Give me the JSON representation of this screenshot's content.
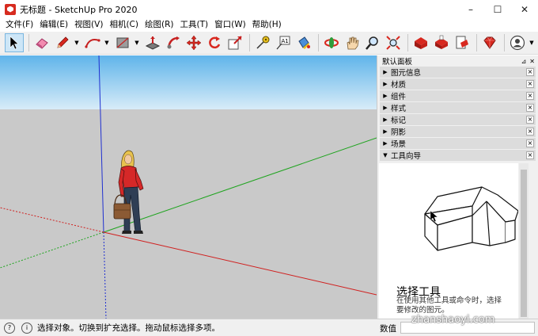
{
  "window": {
    "title": "无标题 - SketchUp Pro 2020",
    "minimize": "–",
    "maximize": "☐",
    "close": "✕"
  },
  "menu": [
    "文件(F)",
    "编辑(E)",
    "视图(V)",
    "相机(C)",
    "绘图(R)",
    "工具(T)",
    "窗口(W)",
    "帮助(H)"
  ],
  "toolbar": {
    "tools": [
      "select-tool",
      "eraser-tool",
      "pencil-tool",
      "arc-tool",
      "shape-tool",
      "push-pull-tool",
      "follow-me-tool",
      "move-tool",
      "rotate-tool",
      "scale-tool",
      "tape-measure-tool",
      "text-tool",
      "paint-bucket-tool",
      "orbit-tool",
      "pan-tool",
      "zoom-tool",
      "zoom-extents-tool",
      "3d-warehouse-tool",
      "extension-warehouse-tool",
      "layout-tool",
      "extension-manager-tool",
      "account-tool"
    ],
    "text_tool_glyph": "A1"
  },
  "tray": {
    "title": "默认面板",
    "pin": "⊿",
    "close": "✕",
    "panels": [
      {
        "label": "图元信息",
        "expanded": false
      },
      {
        "label": "材质",
        "expanded": false
      },
      {
        "label": "组件",
        "expanded": false
      },
      {
        "label": "样式",
        "expanded": false
      },
      {
        "label": "标记",
        "expanded": false
      },
      {
        "label": "阴影",
        "expanded": false
      },
      {
        "label": "场景",
        "expanded": false
      },
      {
        "label": "工具向导",
        "expanded": true
      }
    ],
    "collapsed_glyph": "▶",
    "expanded_glyph": "▼",
    "close_glyph": "×",
    "instructor": {
      "title": "选择工具",
      "description": "在使用其他工具或命令时，选择要修改的图元。"
    }
  },
  "status": {
    "text": "选择对象。切换到扩充选择。拖动鼠标选择多项。",
    "measure_label": "数值",
    "measure_value": ""
  },
  "watermark": "zhanshaoyi.com",
  "colors": {
    "sky_top": "#5fb4ea",
    "sky_bottom": "#d8ecf8",
    "ground": "#c9c9c9",
    "axis_red": "#d0201f",
    "axis_green": "#1fa41f",
    "axis_blue": "#1f2fd0",
    "active_tool": "#cde6f7"
  }
}
